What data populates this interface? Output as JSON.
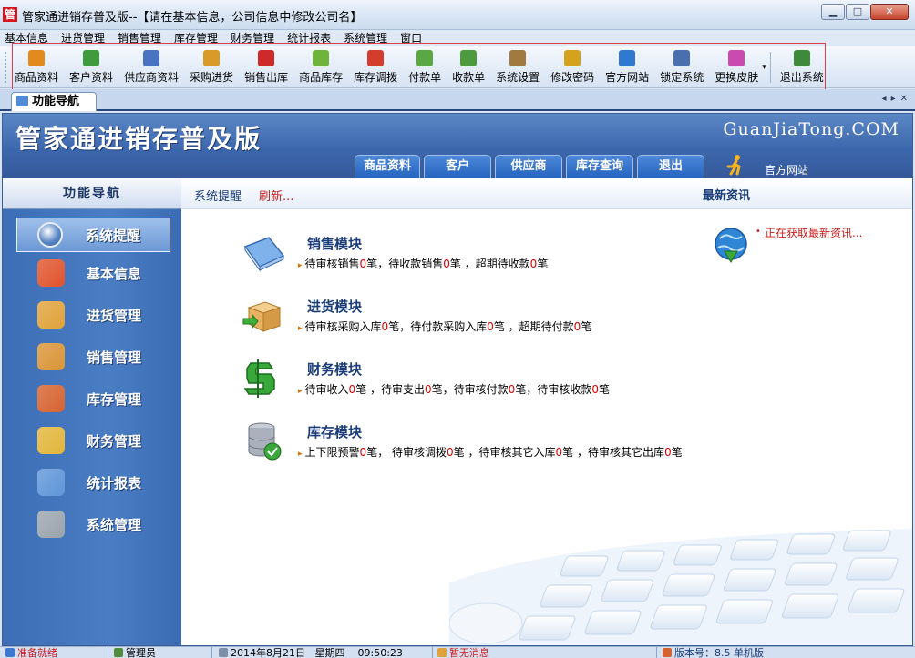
{
  "window": {
    "title": "管家通进销存普及版--【请在基本信息，公司信息中修改公司名】",
    "app_icon_glyph": "管",
    "min_glyph": "▁",
    "max_glyph": "□",
    "close_glyph": "✕"
  },
  "menu": [
    "基本信息",
    "进货管理",
    "销售管理",
    "库存管理",
    "财务管理",
    "统计报表",
    "系统管理",
    "窗口"
  ],
  "toolbar": {
    "items": [
      {
        "label": "商品资料",
        "icon": "goods-icon",
        "color": "#e28a1e"
      },
      {
        "label": "客户资料",
        "icon": "customers-icon",
        "color": "#3f9b3c"
      },
      {
        "label": "供应商资料",
        "icon": "suppliers-icon",
        "color": "#4a73c1"
      },
      {
        "label": "采购进货",
        "icon": "purchase-truck-icon",
        "color": "#d99a2a"
      },
      {
        "label": "销售出库",
        "icon": "shopping-basket-icon",
        "color": "#cf2a2a"
      },
      {
        "label": "商品库存",
        "icon": "stock-box-icon",
        "color": "#6fb43a"
      },
      {
        "label": "库存调拨",
        "icon": "transfer-arrows-icon",
        "color": "#d43c2c"
      },
      {
        "label": "付款单",
        "icon": "payment-icon",
        "color": "#5aa843"
      },
      {
        "label": "收款单",
        "icon": "receipt-icon",
        "color": "#4e9a3e"
      },
      {
        "label": "系统设置",
        "icon": "settings-icon",
        "color": "#a07a3e"
      },
      {
        "label": "修改密码",
        "icon": "pencil-icon",
        "color": "#d5a21e"
      },
      {
        "label": "官方网站",
        "icon": "browser-icon",
        "color": "#2f7ad0"
      },
      {
        "label": "锁定系统",
        "icon": "lock-screen-icon",
        "color": "#4a6fb0"
      },
      {
        "label": "更换皮肤",
        "icon": "palette-icon",
        "color": "#c94bb0"
      }
    ],
    "more_glyph": "▾",
    "exit": {
      "label": "退出系统",
      "icon": "exit-door-icon",
      "color": "#3f8a3a"
    }
  },
  "tabstrip": {
    "active_tab": "功能导航",
    "controls": [
      "◂",
      "▸",
      "✕"
    ]
  },
  "banner": {
    "title": "管家通进销存普及版",
    "domain": "GuanJiaTong.COM",
    "tabs": [
      "商品资料",
      "客户",
      "供应商",
      "库存查询",
      "退出"
    ],
    "official_site": "官方网站"
  },
  "sidebar": {
    "header": "功能导航",
    "items": [
      {
        "label": "系统提醒",
        "icon": "info-icon",
        "color": "#4a7fcf",
        "selected": true
      },
      {
        "label": "基本信息",
        "icon": "cubes-icon",
        "color": "#e0532c",
        "selected": false
      },
      {
        "label": "进货管理",
        "icon": "box-in-icon",
        "color": "#e0a23a",
        "selected": false
      },
      {
        "label": "销售管理",
        "icon": "box-out-icon",
        "color": "#d99436",
        "selected": false
      },
      {
        "label": "库存管理",
        "icon": "warehouse-icon",
        "color": "#d5622f",
        "selected": false
      },
      {
        "label": "财务管理",
        "icon": "finance-icon",
        "color": "#e2b53a",
        "selected": false
      },
      {
        "label": "统计报表",
        "icon": "chart-icon",
        "color": "#5f95d8",
        "selected": false
      },
      {
        "label": "系统管理",
        "icon": "gears-icon",
        "color": "#9aa3ad",
        "selected": false
      }
    ]
  },
  "content": {
    "title": "系统提醒",
    "refresh": "刷新...",
    "news_title": "最新资讯",
    "news_fetch": "正在获取最新资讯...",
    "modules": [
      {
        "title": "销售模块",
        "icon": "sales-book-icon",
        "parts": [
          {
            "t": "待审核销售"
          },
          {
            "n": "0"
          },
          {
            "t": "笔，待收款销售"
          },
          {
            "n": "0"
          },
          {
            "t": "笔 ，超期待收款"
          },
          {
            "n": "0"
          },
          {
            "t": "笔"
          }
        ]
      },
      {
        "title": "进货模块",
        "icon": "purchase-box-icon",
        "parts": [
          {
            "t": "待审核采购入库"
          },
          {
            "n": "0"
          },
          {
            "t": "笔，待付款采购入库"
          },
          {
            "n": "0"
          },
          {
            "t": "笔 ，超期待付款"
          },
          {
            "n": "0"
          },
          {
            "t": "笔"
          }
        ]
      },
      {
        "title": "财务模块",
        "icon": "money-icon",
        "parts": [
          {
            "t": "待审收入"
          },
          {
            "n": "0"
          },
          {
            "t": "笔 ，待审支出"
          },
          {
            "n": "0"
          },
          {
            "t": "笔，待审核付款"
          },
          {
            "n": "0"
          },
          {
            "t": "笔，待审核收款"
          },
          {
            "n": "0"
          },
          {
            "t": "笔"
          }
        ]
      },
      {
        "title": "库存模块",
        "icon": "database-icon",
        "parts": [
          {
            "t": "上下限预警"
          },
          {
            "n": "0"
          },
          {
            "t": "笔，  待审核调拨"
          },
          {
            "n": "0"
          },
          {
            "t": "笔 ，待审核其它入库"
          },
          {
            "n": "0"
          },
          {
            "t": "笔 ，待审核其它出库"
          },
          {
            "n": "0"
          },
          {
            "t": "笔"
          }
        ]
      }
    ]
  },
  "statusbar": {
    "ready": "准备就绪",
    "user": "管理员",
    "date": "2014年8月21日",
    "weekday": "星期四",
    "time": "09:50:23",
    "messages": "暂无消息",
    "version": "版本号：8.5 单机版"
  },
  "colors": {
    "accent_red": "#e00000",
    "banner_blue": "#3d67ad",
    "title_blue": "#1b3d78"
  }
}
